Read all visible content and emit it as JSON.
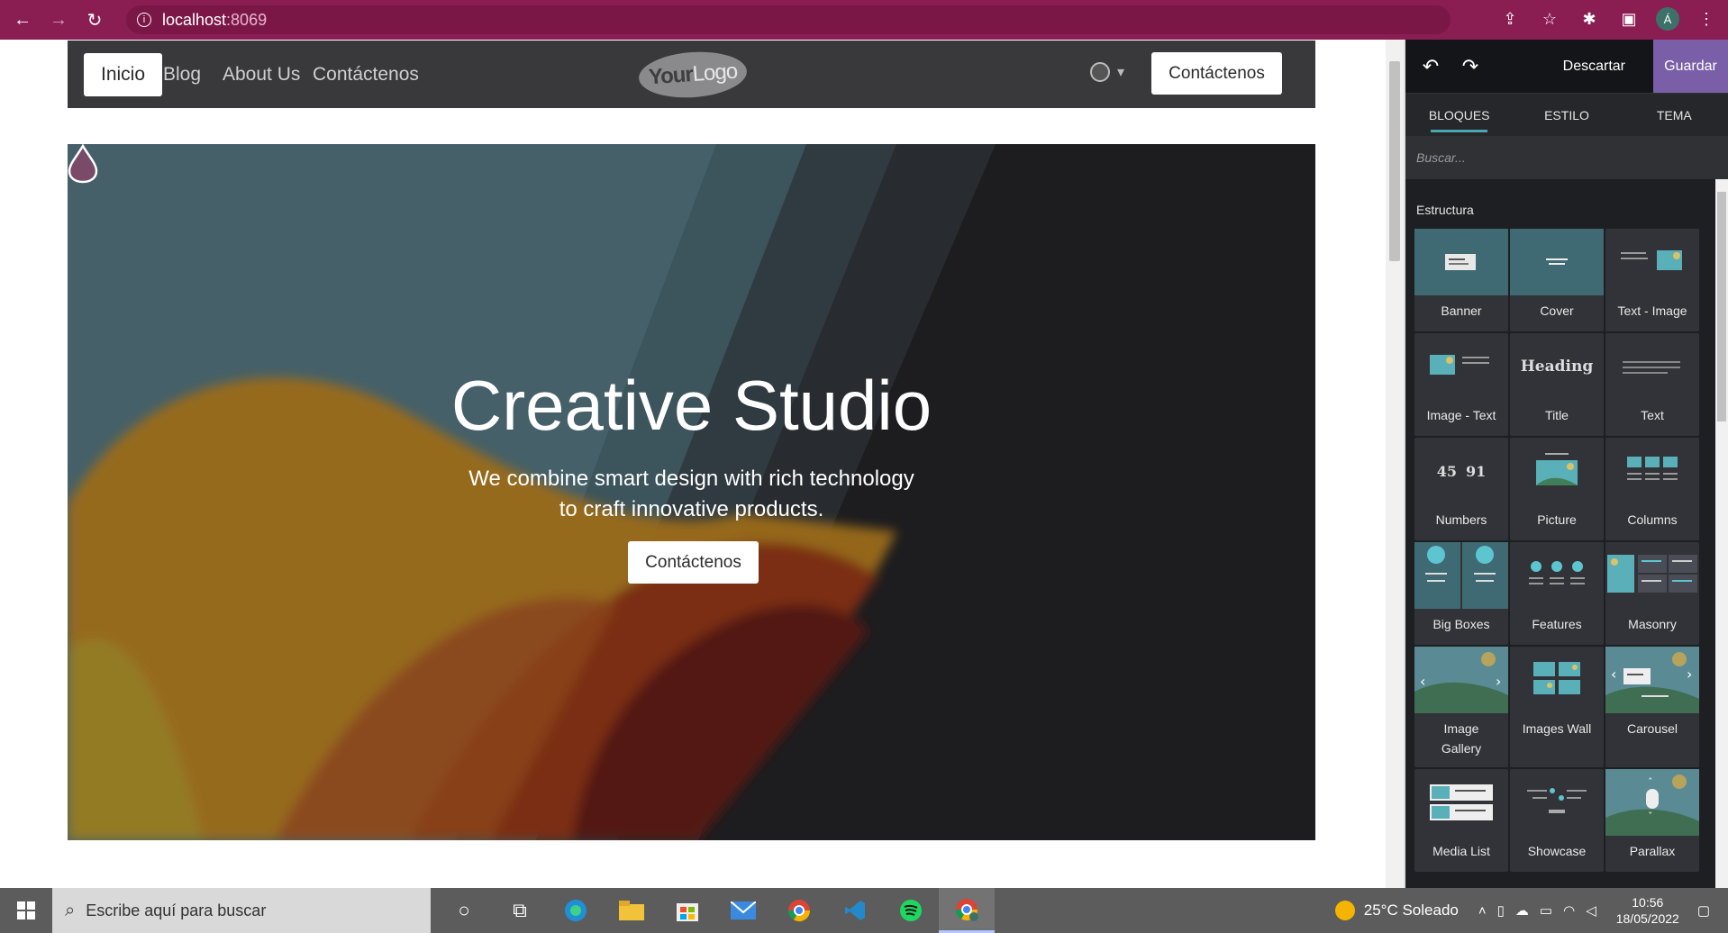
{
  "browser": {
    "url_host": "localhost",
    "url_port": ":8069",
    "avatar_letter": "Á"
  },
  "site": {
    "menu": [
      "Inicio",
      "Blog",
      "About Us",
      "Contáctenos"
    ],
    "logo_bold": "Your",
    "logo_light": "Logo",
    "header_button": "Contáctenos",
    "hero_title": "Creative Studio",
    "hero_sub_line1": "We combine smart design with rich technology",
    "hero_sub_line2": "to craft innovative products.",
    "hero_button": "Contáctenos"
  },
  "editor": {
    "discard": "Descartar",
    "save": "Guardar",
    "tabs": [
      "BLOQUES",
      "ESTILO",
      "TEMA"
    ],
    "search_placeholder": "Buscar...",
    "section": "Estructura",
    "blocks": [
      "Banner",
      "Cover",
      "Text - Image",
      "Image - Text",
      "Title",
      "Text",
      "Numbers",
      "Picture",
      "Columns",
      "Big Boxes",
      "Features",
      "Masonry",
      "Image Gallery",
      "Images Wall",
      "Carousel",
      "Media List",
      "Showcase",
      "Parallax"
    ],
    "title_thumb_text": "Heading",
    "numbers_thumb": [
      "45",
      "91"
    ]
  },
  "taskbar": {
    "search_placeholder": "Escribe aquí para buscar",
    "weather": "25°C  Soleado",
    "time": "10:56",
    "date": "18/05/2022"
  },
  "colors": {
    "browser_bar": "#8a1e52",
    "save_button": "#7a5ea8",
    "tab_accent": "#4aa6b0"
  }
}
